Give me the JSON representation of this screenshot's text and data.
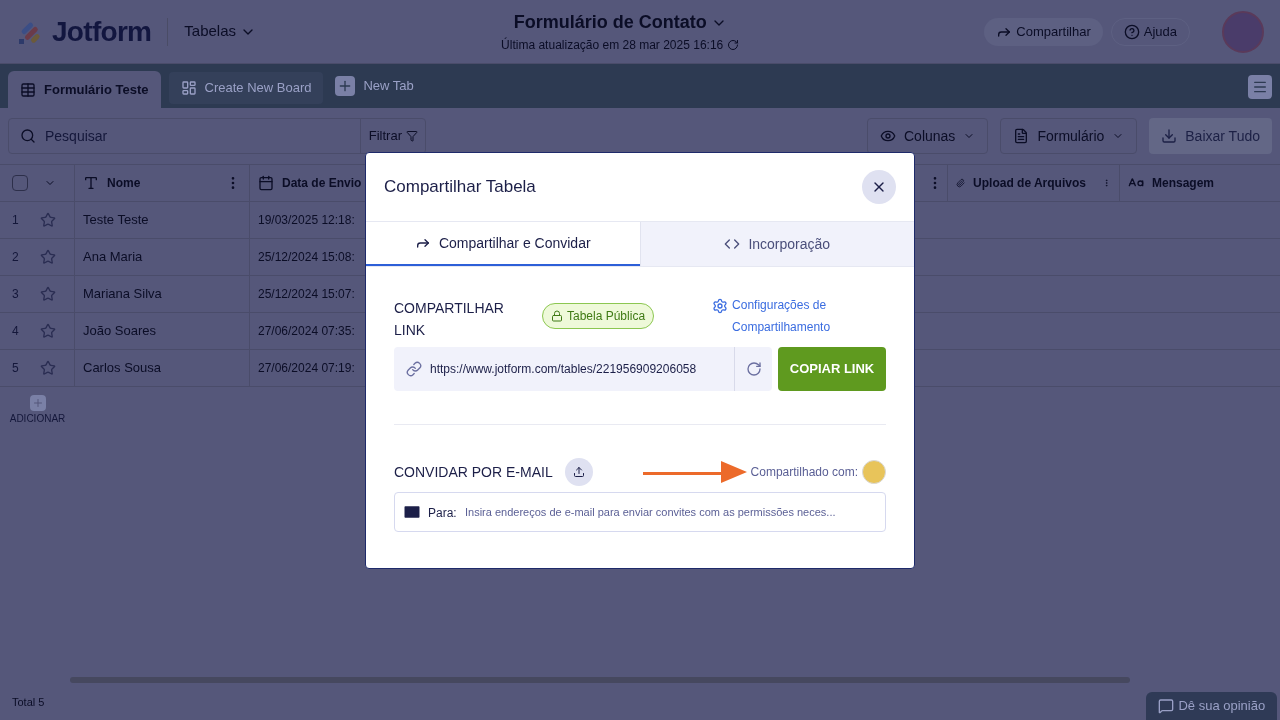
{
  "header": {
    "logo": "Jotform",
    "section": "Tabelas",
    "title": "Formulário de Contato",
    "updated": "Última atualização em 28 mar 2025 16:16",
    "buttons": [
      "Compartilhar",
      "Ajuda"
    ]
  },
  "tabs": [
    {
      "label": "Formulário Teste",
      "selected": true,
      "kind": "table"
    },
    {
      "label": "Create New Board",
      "selected": false,
      "kind": "board"
    },
    {
      "label": "New Tab",
      "selected": false,
      "kind": "new"
    }
  ],
  "toolbar": {
    "search_placeholder": "Pesquisar",
    "filter": "Filtrar",
    "columns": "Colunas",
    "form": "Formulário",
    "download": "Baixar Tudo"
  },
  "table": {
    "select_all_checked": false,
    "columns": [
      {
        "label": "Nome",
        "kind": "text"
      },
      {
        "label": "Data de Envio",
        "kind": "date"
      },
      {
        "label": "Upload de Arquivos",
        "kind": "file"
      },
      {
        "label": "Mensagem",
        "kind": "longtext"
      }
    ],
    "rows": [
      {
        "number": "1",
        "starred": false,
        "name": "Teste Teste",
        "date": "19/03/2025 12:18:"
      },
      {
        "number": "2",
        "starred": false,
        "name": "Ana Maria",
        "date": "25/12/2024 15:08:"
      },
      {
        "number": "3",
        "starred": false,
        "name": "Mariana Silva",
        "date": "25/12/2024 15:07:"
      },
      {
        "number": "4",
        "starred": false,
        "name": "João Soares",
        "date": "27/06/2024 07:35:"
      },
      {
        "number": "5",
        "starred": false,
        "name": "Carlos Sousa",
        "date": "27/06/2024 07:19:"
      }
    ],
    "add": "ADICIONAR"
  },
  "footer": {
    "total": "Total 5",
    "feedback": "Dê sua opinião"
  },
  "modal": {
    "title": "Compartilhar Tabela",
    "tabs": [
      {
        "label": "Compartilhar e Convidar",
        "selected": true,
        "kind": "share"
      },
      {
        "label": "Incorporação",
        "selected": false,
        "kind": "embed"
      }
    ],
    "link_heading": "COMPARTILHAR LINK",
    "public_badge": "Tabela Pública",
    "settings_link": "Configurações de Compartilhamento",
    "url": "https://www.jotform.com/tables/221956909206058",
    "copy_button": "COPIAR LINK",
    "invite_heading": "CONVIDAR POR E-MAIL",
    "shared_with": "Compartilhado com:",
    "to_label": "Para:",
    "email_placeholder": "Insira endereços de e-mail para enviar convites com as permissões neces..."
  }
}
